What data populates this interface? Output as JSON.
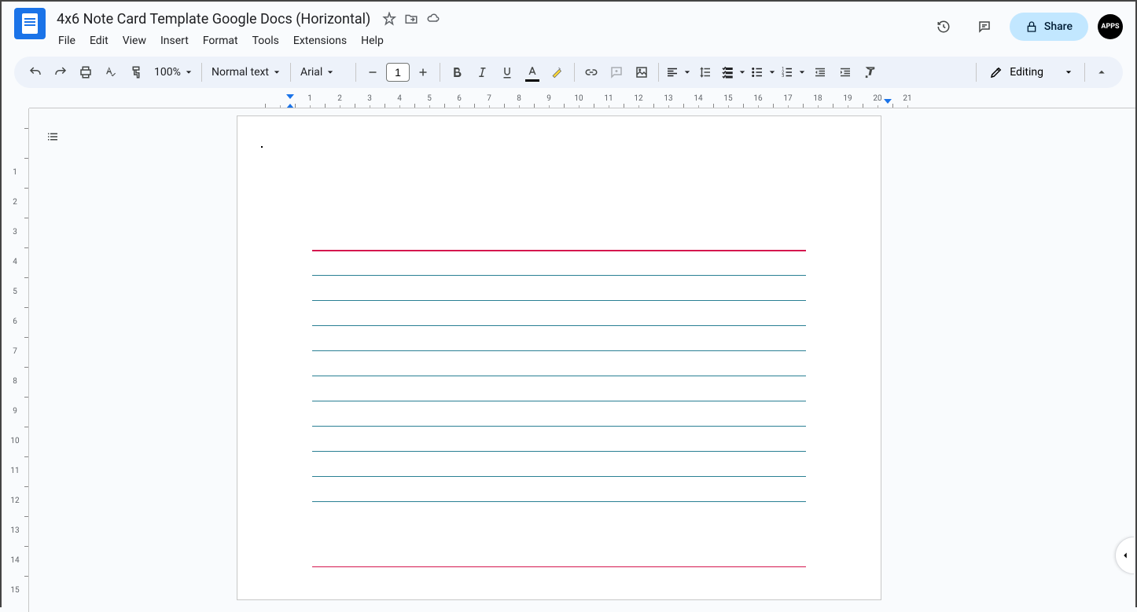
{
  "header": {
    "title": "4x6 Note Card Template Google Docs (Horizontal)",
    "menus": [
      "File",
      "Edit",
      "View",
      "Insert",
      "Format",
      "Tools",
      "Extensions",
      "Help"
    ],
    "share_label": "Share",
    "avatar_text": "APPS"
  },
  "toolbar": {
    "zoom": "100%",
    "style": "Normal text",
    "font": "Arial",
    "font_size": "1",
    "editing_label": "Editing"
  },
  "ruler": {
    "h_ticks": [
      "",
      "1",
      "2",
      "3",
      "4",
      "5",
      "6",
      "7",
      "8",
      "9",
      "10",
      "11",
      "12",
      "13",
      "14",
      "15",
      "16",
      "17",
      "18",
      "19",
      "20",
      "21"
    ],
    "v_ticks": [
      "",
      "1",
      "2",
      "3",
      "4",
      "5",
      "6",
      "7",
      "8",
      "9",
      "10",
      "11",
      "12",
      "13",
      "14",
      "15"
    ]
  },
  "document": {
    "card_lines": {
      "red_top": 1,
      "blue_count": 10,
      "red_bottom": 1
    }
  },
  "colors": {
    "accent_blue": "#1a73e8",
    "share_bg": "#c2e7ff",
    "red_line": "#d5174e",
    "blue_line": "#2a8094"
  }
}
